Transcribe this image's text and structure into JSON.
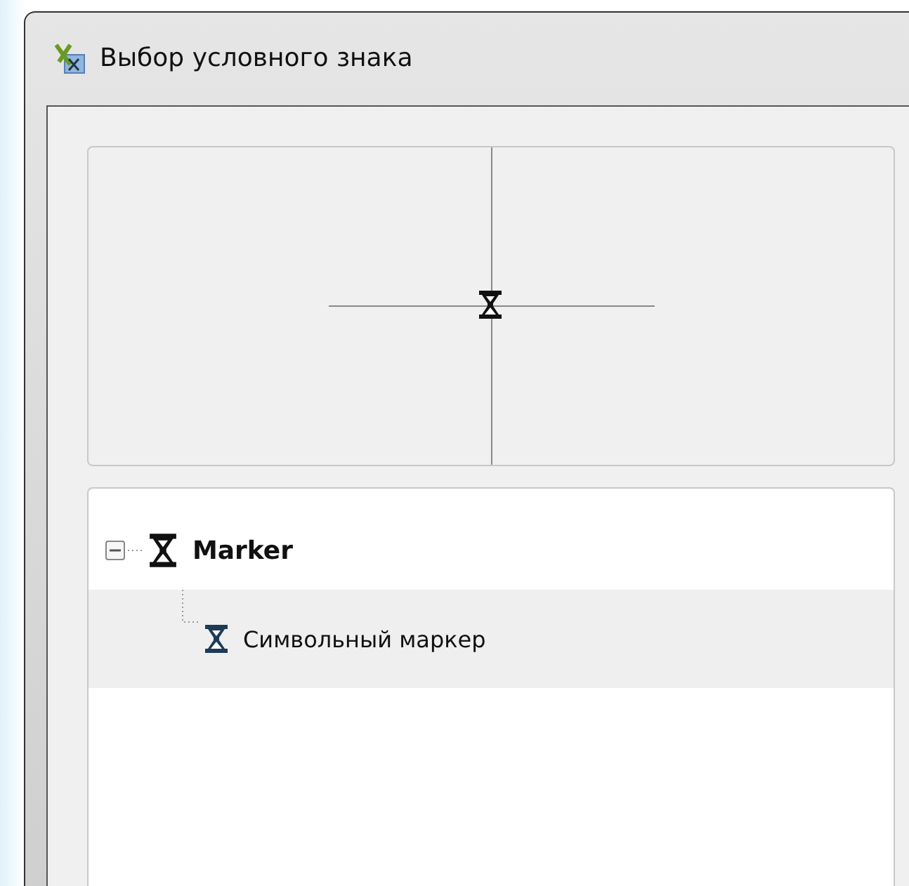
{
  "window": {
    "title": "Выбор условного знака"
  },
  "tree": [
    {
      "label": "Marker",
      "expanded": true,
      "selected": false,
      "children": [
        {
          "label": "Символьный маркер",
          "selected": true
        }
      ]
    }
  ]
}
